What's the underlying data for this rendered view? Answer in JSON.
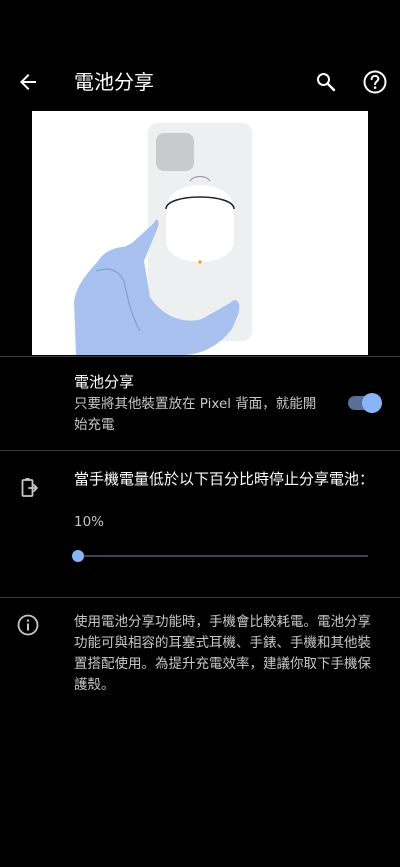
{
  "app_bar": {
    "title": "電池分享",
    "back_icon": "arrow-back-icon",
    "search_icon": "search-icon",
    "help_icon": "help-circle-icon"
  },
  "battery_share": {
    "title": "電池分享",
    "summary": "只要將其他裝置放在 Pixel 背面，就能開始充電",
    "toggle_on": true
  },
  "stop_threshold": {
    "icon": "battery-share-icon",
    "title": "當手機電量低於以下百分比時停止分享電池：",
    "value_text": "10%",
    "slider_fraction": 0.0
  },
  "info": {
    "icon": "info-icon",
    "text": "使用電池分享功能時，手機會比較耗電。電池分享功能可與相容的耳塞式耳機、手錶、手機和其他裝置搭配使用。為提升充電效率，建議你取下手機保護殼。"
  },
  "colors": {
    "background": "#000000",
    "accent": "#8ab4f8",
    "toggle_track": "#5b6f95",
    "divider": "#3c3c3c",
    "secondary_text": "#c7c7c7"
  }
}
